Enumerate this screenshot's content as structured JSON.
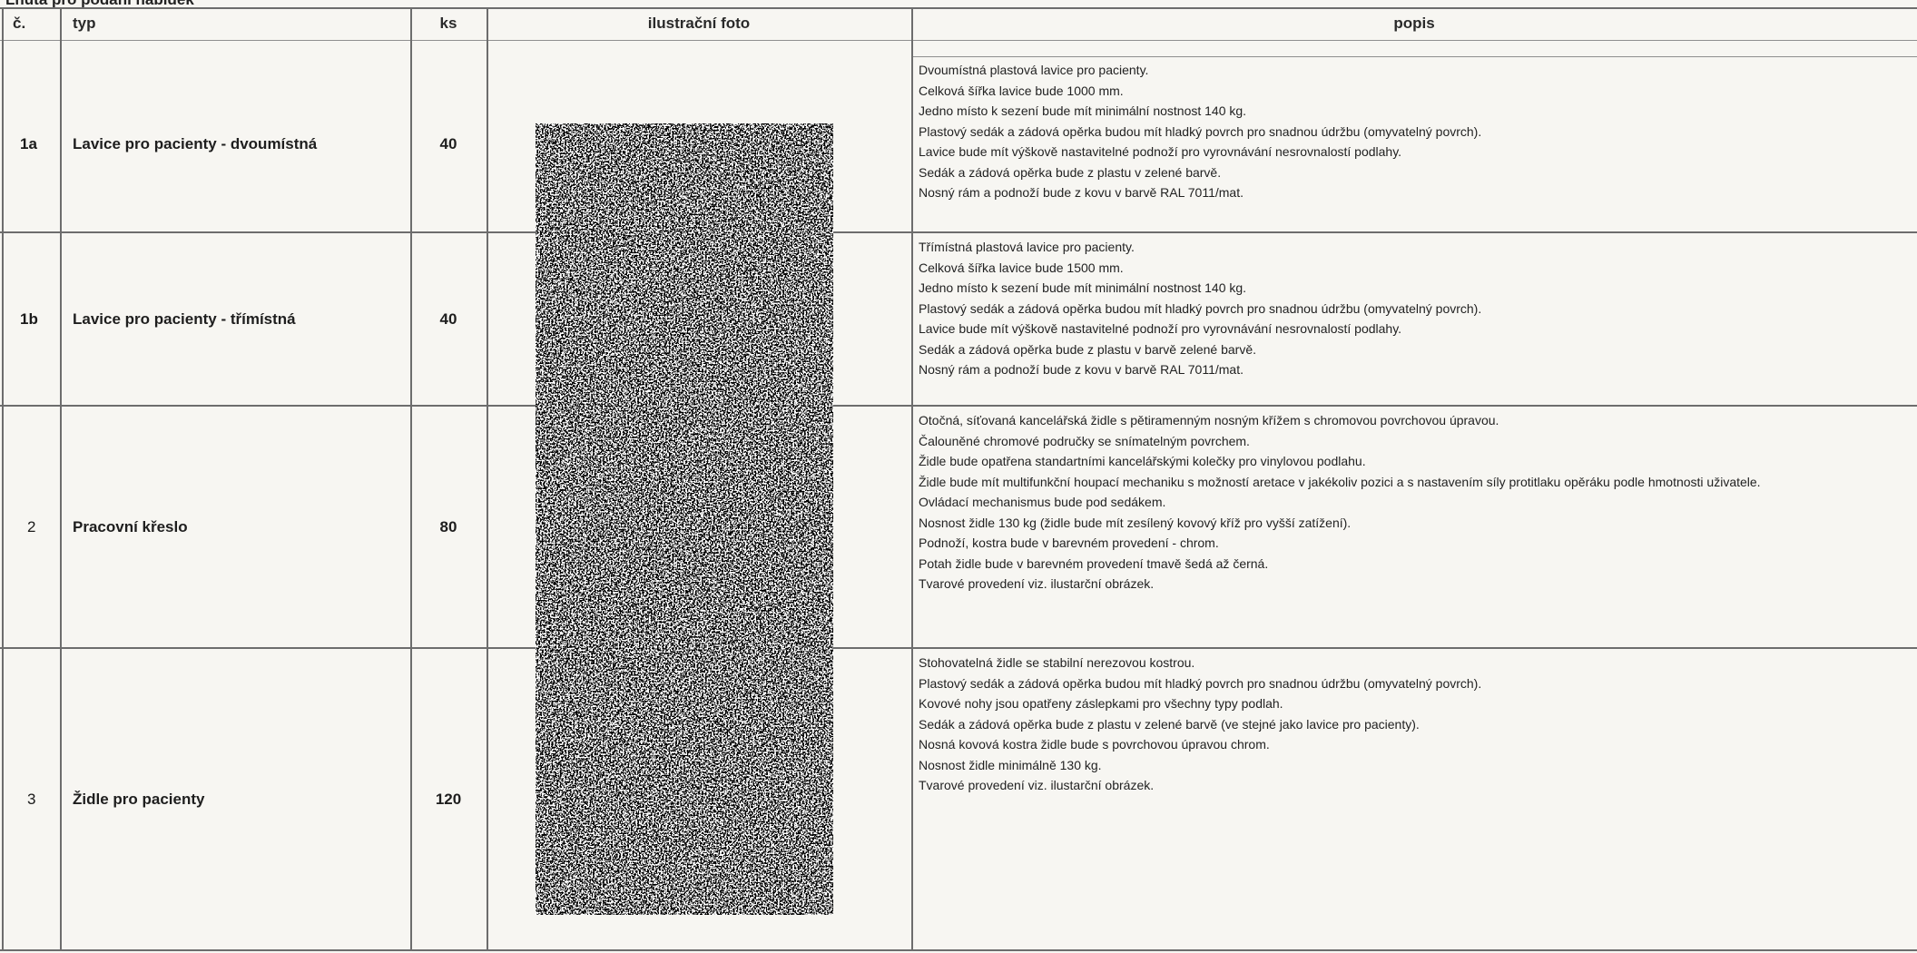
{
  "page_header_fragment": "Lhůta pro podání nabídek",
  "table": {
    "headers": {
      "no": "č.",
      "type": "typ",
      "qty": "ks",
      "photo": "ilustrační foto",
      "desc": "popis"
    },
    "rows": [
      {
        "no": "1a",
        "type": "Lavice pro pacienty - dvoumístná",
        "qty": "40",
        "desc": [
          "Dvoumístná plastová lavice pro pacienty.",
          "Celková šířka lavice bude 1000 mm.",
          "Jedno místo k sezení bude mít minimální nostnost 140 kg.",
          "Plastový sedák a zádová opěrka budou mít hladký povrch pro snadnou údržbu (omyvatelný povrch).",
          "Lavice bude mít výškově nastavitelné podnoží pro vyrovnávání nesrovnalostí podlahy.",
          "Sedák a zádová opěrka bude z plastu v zelené barvě.",
          "Nosný rám a podnoží bude z kovu v barvě RAL 7011/mat."
        ]
      },
      {
        "no": "1b",
        "type": "Lavice pro pacienty - třímístná",
        "qty": "40",
        "desc": [
          "Třímístná plastová lavice pro pacienty.",
          "Celková šířka lavice bude 1500 mm.",
          "Jedno místo k sezení bude mít minimální nostnost 140 kg.",
          "Plastový sedák a zádová opěrka budou mít hladký povrch pro snadnou údržbu (omyvatelný povrch).",
          "Lavice bude mít výškově nastavitelné podnoží pro vyrovnávání nesrovnalostí podlahy.",
          "Sedák a zádová opěrka bude z plastu v barvě zelené barvě.",
          "Nosný rám a podnoží bude z kovu v barvě RAL 7011/mat."
        ]
      },
      {
        "no": "2",
        "type": "Pracovní křeslo",
        "qty": "80",
        "desc": [
          "Otočná, síťovaná kancelářská židle s pětiramenným nosným křížem s chromovou povrchovou úpravou.",
          "Čalouněné chromové područky se snímatelným povrchem.",
          "Židle bude opatřena standartními kancelářskými kolečky pro vinylovou podlahu.",
          "Židle bude mít multifunkční houpací mechaniku s možností aretace v jakékoliv pozici a s nastavením síly protitlaku opěráku podle hmotnosti uživatele.",
          "Ovládací mechanismus bude pod sedákem.",
          "Nosnost židle 130 kg (židle bude mít zesílený kovový kříž pro vyšší zatížení).",
          "Podnoží, kostra bude v barevném provedení - chrom.",
          "Potah židle bude v barevném provedení tmavě šedá až černá.",
          "Tvarové provedení viz. ilustarční obrázek."
        ]
      },
      {
        "no": "3",
        "type": "Židle pro pacienty",
        "qty": "120",
        "desc": [
          "Stohovatelná židle se stabilní nerezovou kostrou.",
          "Plastový sedák a zádová opěrka budou mít hladký povrch pro snadnou údržbu (omyvatelný povrch).",
          "Kovové nohy jsou opatřeny záslepkami pro všechny typy podlah.",
          "Sedák a zádová opěrka bude z plastu v zelené barvě (ve stejné jako lavice pro pacienty).",
          "Nosná kovová kostra  židle bude s povrchovou úpravou chrom.",
          "Nosnost židle minimálně 130 kg.",
          "Tvarové provedení viz. ilustarční obrázek."
        ]
      }
    ]
  }
}
